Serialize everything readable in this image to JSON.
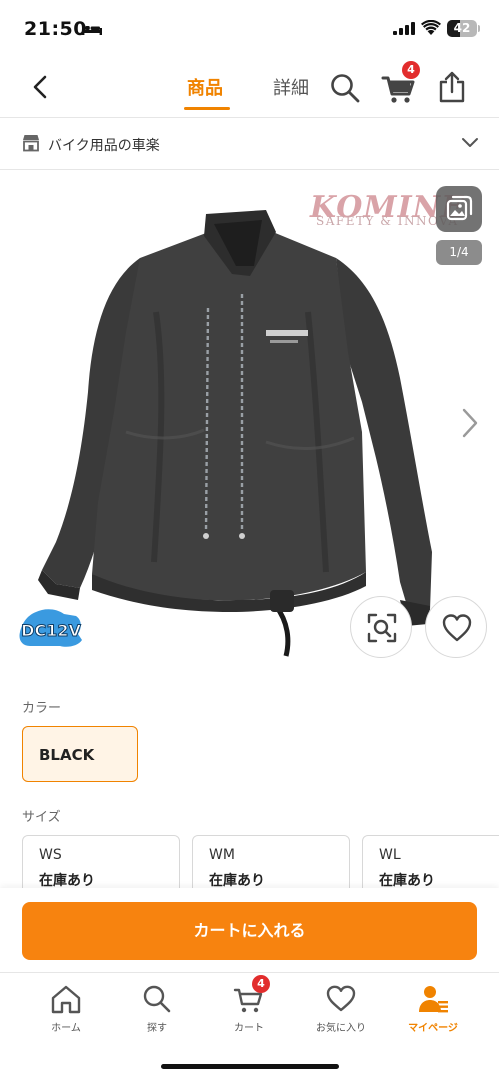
{
  "status_bar": {
    "time": "21:50",
    "battery_level": 42,
    "battery_text": "42"
  },
  "nav": {
    "tabs": [
      {
        "label": "商品",
        "active": true
      },
      {
        "label": "詳細",
        "active": false
      }
    ],
    "cart_badge": "4",
    "icons": [
      "chevron-left-icon",
      "search-icon",
      "cart-icon",
      "share-icon"
    ]
  },
  "shop": {
    "name": "バイク用品の車楽",
    "icon": "store-icon"
  },
  "gallery": {
    "brand_logo": "KOMINE",
    "brand_tagline": "SAFETY & INNOVA",
    "page_indicator": "1/4",
    "badge_text": "DC12V",
    "icons": [
      "gallery-icon",
      "chevron-right-icon",
      "zoom-icon",
      "heart-icon"
    ]
  },
  "options": {
    "color_label": "カラー",
    "colors": [
      {
        "label": "BLACK",
        "selected": true
      }
    ],
    "size_label": "サイズ",
    "sizes": [
      {
        "name": "WS",
        "stock": "在庫あり"
      },
      {
        "name": "WM",
        "stock": "在庫あり"
      },
      {
        "name": "WL",
        "stock": "在庫あり"
      }
    ]
  },
  "cta": {
    "add_to_cart": "カートに入れる"
  },
  "tab_bar": {
    "items": [
      {
        "label": "ホーム",
        "icon": "home-icon"
      },
      {
        "label": "探す",
        "icon": "search-icon"
      },
      {
        "label": "カート",
        "icon": "cart-icon"
      },
      {
        "label": "お気に入り",
        "icon": "heart-icon"
      },
      {
        "label": "マイページ",
        "icon": "user-icon",
        "active": true
      }
    ],
    "cart_badge": "4"
  },
  "colors": {
    "accent": "#f08300",
    "cta": "#f7830f",
    "badge": "#e22d2d"
  }
}
